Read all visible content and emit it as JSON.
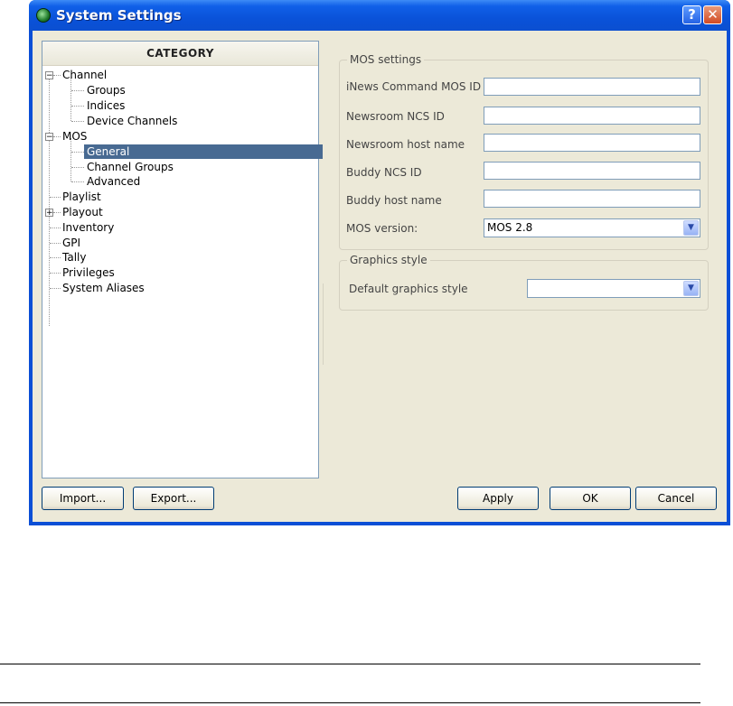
{
  "window": {
    "title": "System Settings",
    "help_button": "?",
    "close_button": "✕"
  },
  "category": {
    "header": "CATEGORY",
    "tree": [
      {
        "label": "Channel",
        "expander": "−"
      },
      {
        "label": "Groups"
      },
      {
        "label": "Indices"
      },
      {
        "label": "Device Channels"
      },
      {
        "label": "MOS",
        "expander": "−"
      },
      {
        "label": "General",
        "selected": true
      },
      {
        "label": "Channel Groups"
      },
      {
        "label": "Advanced"
      },
      {
        "label": "Playlist"
      },
      {
        "label": "Playout",
        "expander": "+"
      },
      {
        "label": "Inventory"
      },
      {
        "label": "GPI"
      },
      {
        "label": "Tally"
      },
      {
        "label": "Privileges"
      },
      {
        "label": "System Aliases"
      }
    ]
  },
  "mos_settings": {
    "legend": "MOS settings",
    "fields": [
      {
        "label": "iNews Command MOS ID",
        "value": ""
      },
      {
        "label": "Newsroom NCS ID",
        "value": ""
      },
      {
        "label": "Newsroom host name",
        "value": ""
      },
      {
        "label": "Buddy NCS ID",
        "value": ""
      },
      {
        "label": "Buddy host name",
        "value": ""
      }
    ],
    "version_label": "MOS version:",
    "version_value": "MOS 2.8"
  },
  "graphics_style": {
    "legend": "Graphics style",
    "label": "Default graphics style",
    "value": ""
  },
  "buttons": {
    "import": "Import...",
    "export": "Export...",
    "apply": "Apply",
    "ok": "OK",
    "cancel": "Cancel"
  },
  "icons": {
    "dropdown": "chevron-down-icon",
    "app": "app-icon"
  }
}
